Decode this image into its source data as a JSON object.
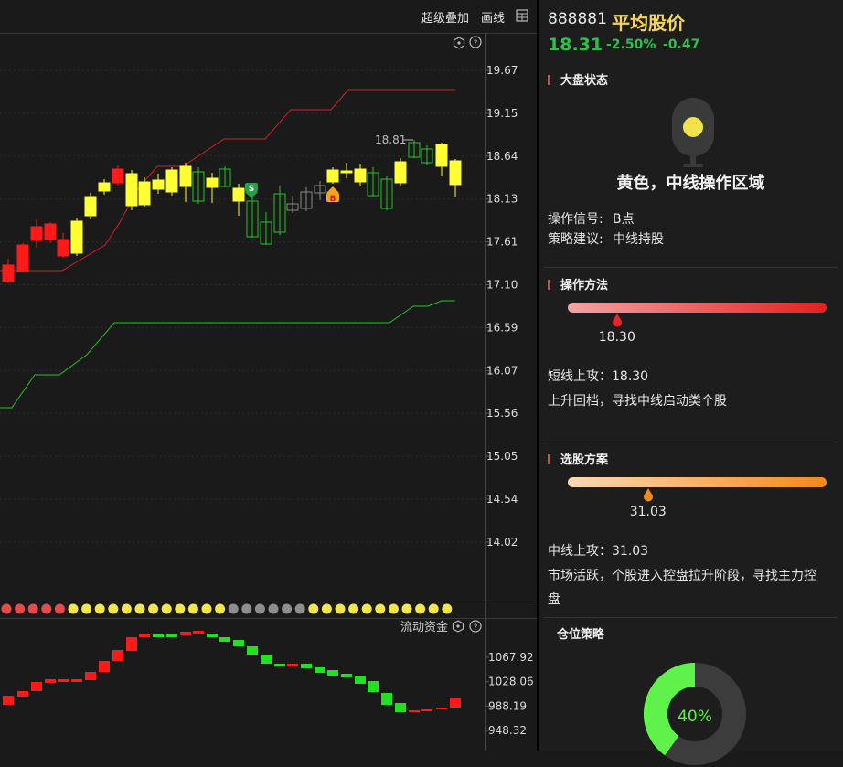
{
  "toolbar": {
    "overlay_label": "超级叠加",
    "draw_label": "画线"
  },
  "main_chart": {
    "price_axis": [
      "19.67",
      "19.15",
      "18.64",
      "18.13",
      "17.61",
      "17.10",
      "16.59",
      "16.07",
      "15.56",
      "15.05",
      "14.54",
      "14.02"
    ],
    "marker_label": "18.81",
    "signals": {
      "sell": "S",
      "buy": "B"
    },
    "colors": {
      "up": "#ff0000",
      "yellow": "#ffff33",
      "green": "#27c127",
      "resistance": "#d4202a",
      "support": "#27c127"
    }
  },
  "dots": [
    "red",
    "red",
    "red",
    "red",
    "red",
    "yellow",
    "yellow",
    "yellow",
    "yellow",
    "yellow",
    "yellow",
    "yellow",
    "yellow",
    "yellow",
    "yellow",
    "yellow",
    "yellow",
    "grey",
    "grey",
    "grey",
    "grey",
    "grey",
    "grey",
    "yellow",
    "yellow",
    "yellow",
    "yellow",
    "yellow",
    "yellow",
    "yellow",
    "yellow",
    "yellow",
    "yellow",
    "yellow"
  ],
  "flow": {
    "title": "流动资金",
    "axis": [
      "1067.92",
      "1028.06",
      "988.19",
      "948.32"
    ]
  },
  "stock": {
    "code": "888881",
    "name": "平均股价",
    "price": "18.31",
    "change_pct": "-2.50%",
    "change": "-0.47"
  },
  "market": {
    "title": "大盘状态",
    "status": "黄色，中线操作区域",
    "signal_label": "操作信号:",
    "signal_value": "B点",
    "advice_label": "策略建议:",
    "advice_value": "中线持股"
  },
  "method": {
    "title": "操作方法",
    "marker_value": "18.30",
    "marker_fraction": 0.19,
    "line1": "短线上攻：18.30",
    "line2": "上升回档，寻找中线启动类个股"
  },
  "selection": {
    "title": "选股方案",
    "marker_value": "31.03",
    "marker_fraction": 0.31,
    "line1": "中线上攻：31.03",
    "line2": "市场活跃，个股进入控盘拉升阶段，寻找主力控",
    "line3": "盘"
  },
  "position": {
    "title": "仓位策略",
    "percent_label": "40%",
    "fraction": 0.4
  }
}
